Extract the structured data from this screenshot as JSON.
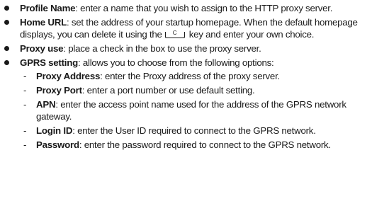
{
  "items": [
    {
      "term": "Profile Name",
      "text": ": enter a name that you wish to assign to the HTTP proxy server."
    },
    {
      "term": "Home URL",
      "text_before_key": ": set the address of your startup homepage. When the default homepage displays, you can delete it using the",
      "key_label": "C",
      "text_after_key": "key and enter your own choice."
    },
    {
      "term": "Proxy use",
      "text": ": place a check in the box to use the proxy server."
    },
    {
      "term": "GPRS setting",
      "text": ": allows you to choose from the following options:",
      "sub_items": [
        {
          "dash": "-",
          "term": "Proxy Address",
          "text": ": enter the Proxy address of the proxy server."
        },
        {
          "dash": "-",
          "term": "Proxy Port",
          "text": ": enter a port number or use default setting."
        },
        {
          "dash": "-",
          "term": "APN",
          "text": ": enter the access point name used for the address of the GPRS network gateway."
        },
        {
          "dash": "-",
          "term": "Login ID",
          "text": ": enter the User ID required to connect to the GPRS network."
        },
        {
          "dash": "-",
          "term": "Password",
          "text": ": enter the password required to connect to the GPRS network."
        }
      ]
    }
  ]
}
